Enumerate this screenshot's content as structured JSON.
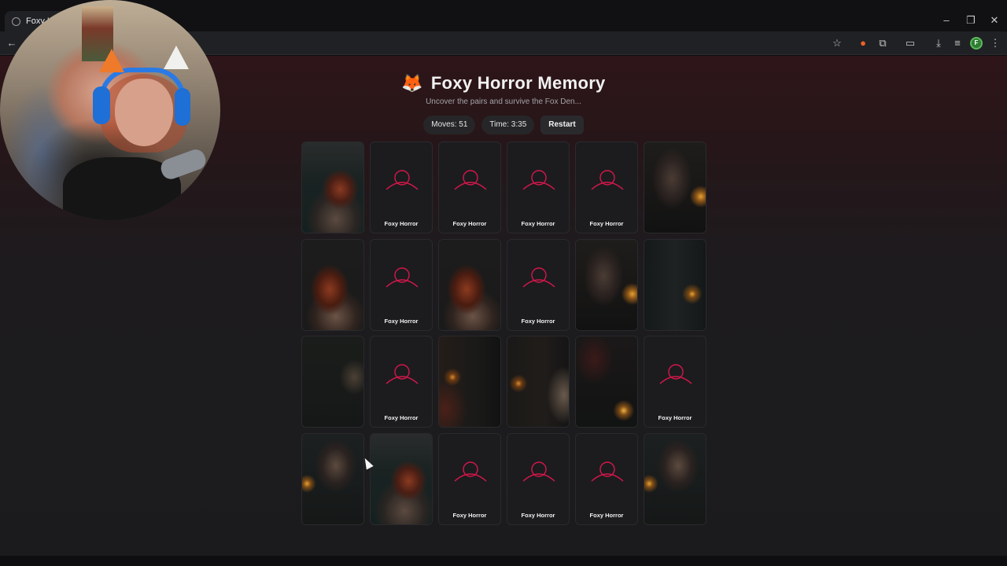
{
  "browser": {
    "tab_title": "Foxy H",
    "window_controls": [
      "–",
      "❐",
      "✕"
    ],
    "toolbar_icons": [
      "back-icon",
      "star-icon",
      "fox-extension-icon",
      "puzzle-icon",
      "screen-cast-icon",
      "download-icon",
      "media-icon",
      "menu-icon"
    ],
    "profile_initial": "F"
  },
  "game": {
    "emoji": "🦊",
    "title": "Foxy Horror Memory",
    "subtitle": "Uncover the pairs and survive the Fox Den...",
    "moves_label": "Moves: 51",
    "time_label": "Time: 3:35",
    "restart_label": "Restart",
    "card_back_label": "Foxy Horror",
    "accent_color": "#d4174a",
    "cards": [
      {
        "state": "face",
        "art": "a"
      },
      {
        "state": "back"
      },
      {
        "state": "back"
      },
      {
        "state": "back"
      },
      {
        "state": "back"
      },
      {
        "state": "face",
        "art": "c"
      },
      {
        "state": "face",
        "art": "b"
      },
      {
        "state": "back"
      },
      {
        "state": "face",
        "art": "b"
      },
      {
        "state": "back"
      },
      {
        "state": "face",
        "art": "c"
      },
      {
        "state": "face",
        "art": "d"
      },
      {
        "state": "face",
        "art": "e"
      },
      {
        "state": "back"
      },
      {
        "state": "face",
        "art": "f"
      },
      {
        "state": "face",
        "art": "g"
      },
      {
        "state": "face",
        "art": "h"
      },
      {
        "state": "back"
      },
      {
        "state": "face",
        "art": "i"
      },
      {
        "state": "face",
        "art": "a"
      },
      {
        "state": "back"
      },
      {
        "state": "back"
      },
      {
        "state": "back"
      },
      {
        "state": "face",
        "art": "i"
      }
    ]
  }
}
